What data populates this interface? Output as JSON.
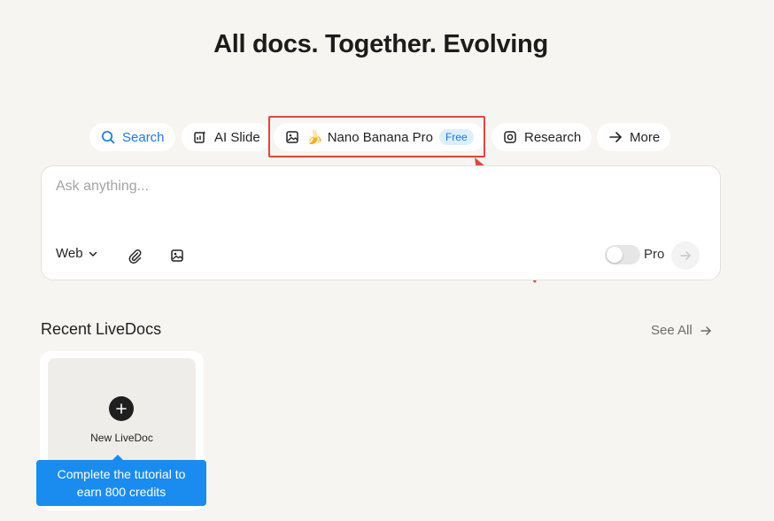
{
  "headline": "All docs. Together. Evolving",
  "chips": [
    {
      "label": "Search",
      "icon": "search-icon"
    },
    {
      "label": "AI Slide",
      "icon": "slide-icon"
    },
    {
      "label": "Nano Banana Pro",
      "icon": "image-icon",
      "emoji": "🍌",
      "badge": "Free"
    },
    {
      "label": "Research",
      "icon": "research-icon"
    },
    {
      "label": "More",
      "icon": "arrow-right-icon"
    }
  ],
  "composer": {
    "placeholder": "Ask anything...",
    "web_label": "Web",
    "pro_label": "Pro",
    "pro_enabled": false
  },
  "recent": {
    "title": "Recent LiveDocs",
    "see_all": "See All",
    "new_label": "New LiveDoc"
  },
  "tooltip": {
    "line1": "Complete the tutorial to",
    "line2": "earn 800 credits"
  },
  "colors": {
    "accent": "#1b76e6",
    "highlight": "#e2453c",
    "tooltip": "#1a8cf0",
    "background": "#f6f5f2"
  }
}
